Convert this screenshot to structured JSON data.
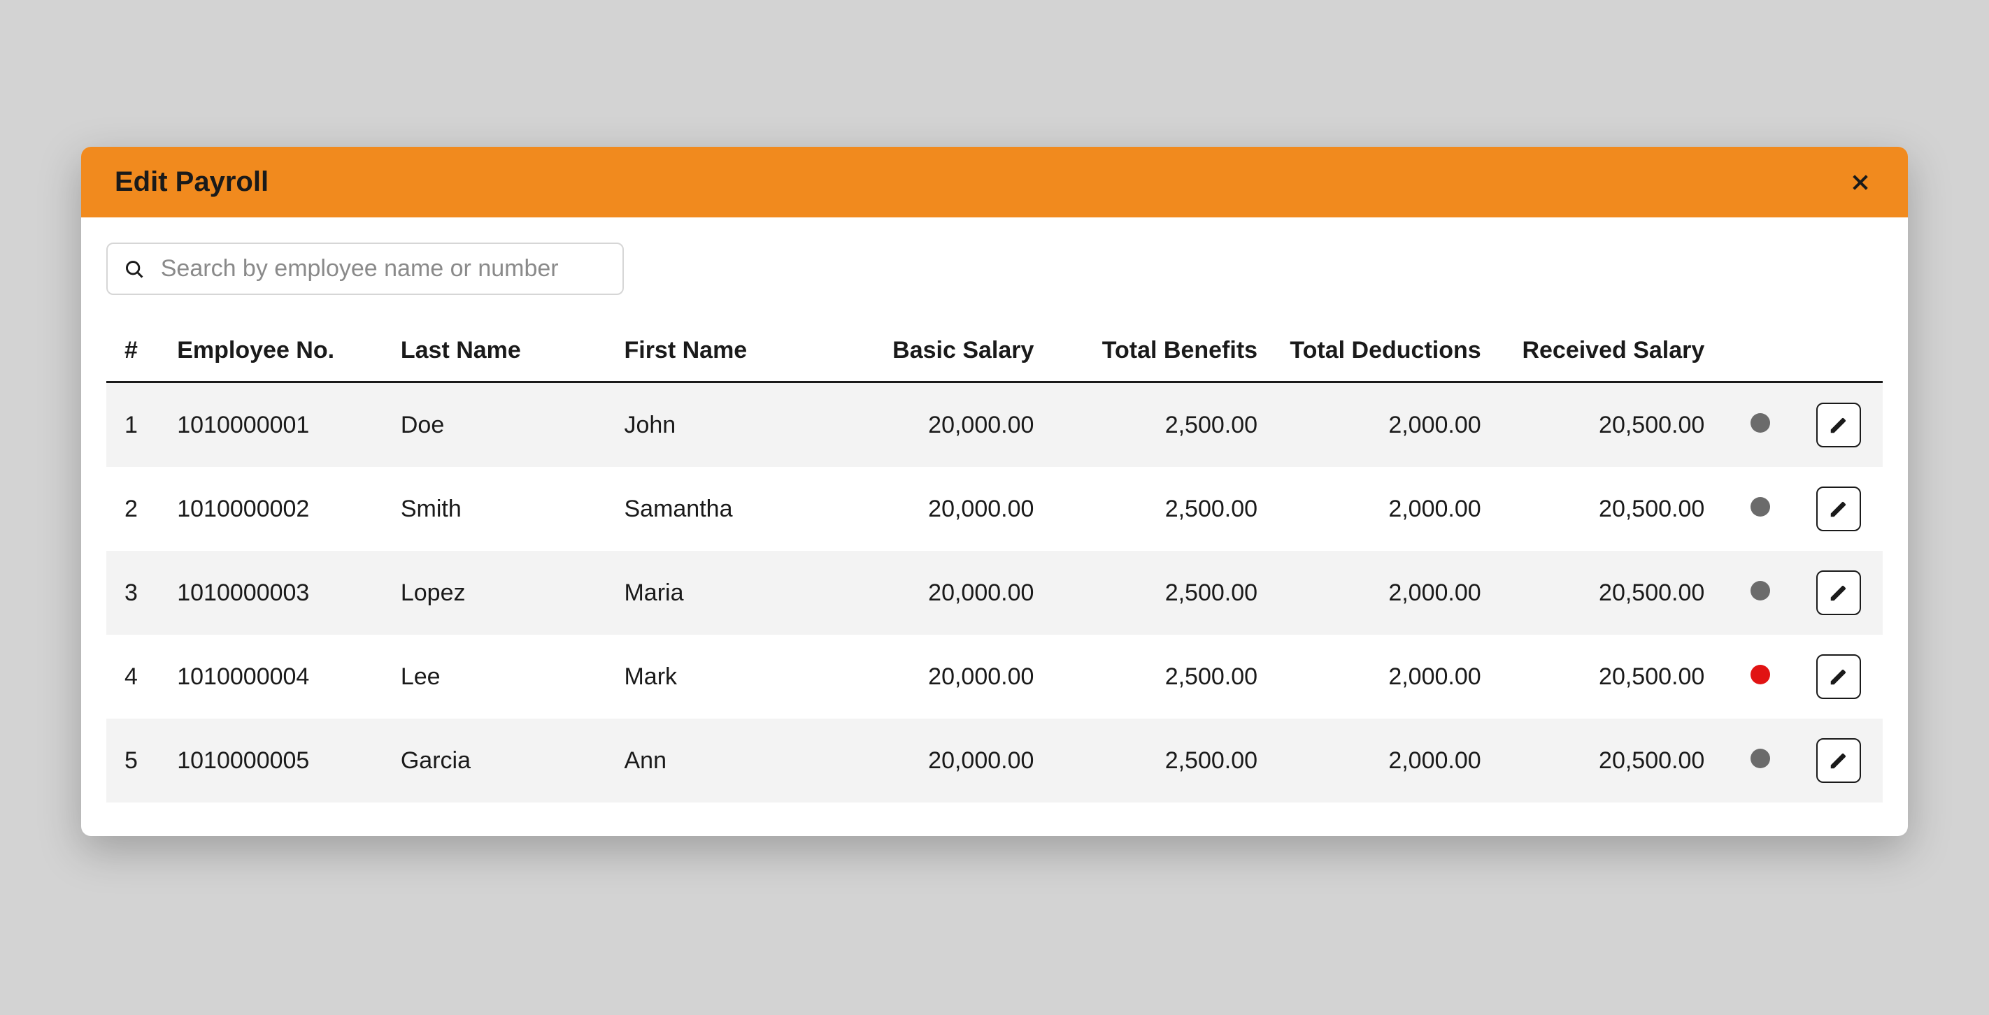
{
  "header": {
    "title": "Edit Payroll"
  },
  "search": {
    "placeholder": "Search by employee name or number"
  },
  "table": {
    "columns": {
      "index": "#",
      "employeeNo": "Employee No.",
      "lastName": "Last Name",
      "firstName": "First Name",
      "basicSalary": "Basic Salary",
      "totalBenefits": "Total Benefits",
      "totalDeductions": "Total Deductions",
      "receivedSalary": "Received Salary"
    },
    "rows": [
      {
        "index": "1",
        "employeeNo": "1010000001",
        "lastName": "Doe",
        "firstName": "John",
        "basicSalary": "20,000.00",
        "totalBenefits": "2,500.00",
        "totalDeductions": "2,000.00",
        "receivedSalary": "20,500.00",
        "status": "gray"
      },
      {
        "index": "2",
        "employeeNo": "1010000002",
        "lastName": "Smith",
        "firstName": "Samantha",
        "basicSalary": "20,000.00",
        "totalBenefits": "2,500.00",
        "totalDeductions": "2,000.00",
        "receivedSalary": "20,500.00",
        "status": "gray"
      },
      {
        "index": "3",
        "employeeNo": "1010000003",
        "lastName": "Lopez",
        "firstName": "Maria",
        "basicSalary": "20,000.00",
        "totalBenefits": "2,500.00",
        "totalDeductions": "2,000.00",
        "receivedSalary": "20,500.00",
        "status": "gray"
      },
      {
        "index": "4",
        "employeeNo": "1010000004",
        "lastName": "Lee",
        "firstName": "Mark",
        "basicSalary": "20,000.00",
        "totalBenefits": "2,500.00",
        "totalDeductions": "2,000.00",
        "receivedSalary": "20,500.00",
        "status": "red"
      },
      {
        "index": "5",
        "employeeNo": "1010000005",
        "lastName": "Garcia",
        "firstName": "Ann",
        "basicSalary": "20,000.00",
        "totalBenefits": "2,500.00",
        "totalDeductions": "2,000.00",
        "receivedSalary": "20,500.00",
        "status": "gray"
      }
    ]
  }
}
